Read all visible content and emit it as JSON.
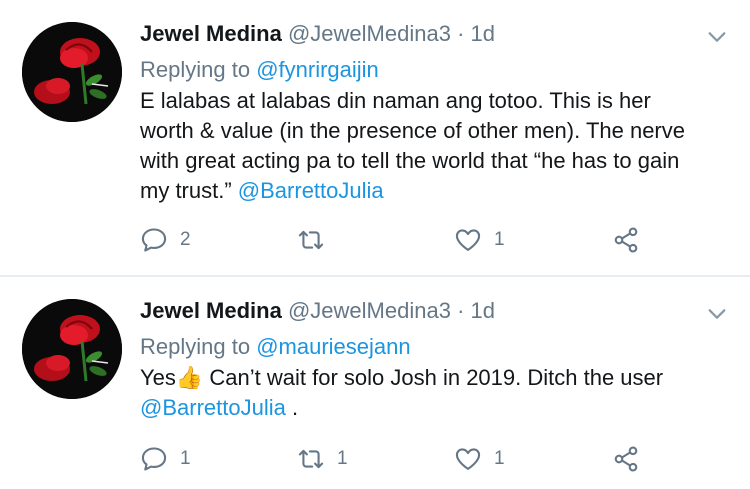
{
  "tweets": [
    {
      "author_name": "Jewel Medina",
      "handle": "@JewelMedina3",
      "separator": "·",
      "time": "1d",
      "replying_prefix": "Replying to",
      "replying_to": "@fynrirgaijin",
      "text_lines": [
        "E lalabas at lalabas din naman ang totoo. This is her",
        "worth & value (in the presence of other men). The nerve",
        "with great acting pa to tell the world that “he has to gain",
        "my trust.”"
      ],
      "trailing_mention": "@BarrettoJulia",
      "reply_count": "2",
      "retweet_count": "",
      "like_count": "1"
    },
    {
      "author_name": "Jewel Medina",
      "handle": "@JewelMedina3",
      "separator": "·",
      "time": "1d",
      "replying_prefix": "Replying to",
      "replying_to": "@mauriesejann",
      "text_before_emoji": "Yes",
      "emoji": "👍",
      "text_after_emoji": " Can’t wait for solo Josh in 2019. Ditch the user",
      "trailing_mention": "@BarrettoJulia",
      "trailing_text": " .",
      "reply_count": "1",
      "retweet_count": "1",
      "like_count": "1"
    }
  ],
  "icons": {
    "reply": "reply-icon",
    "retweet": "retweet-icon",
    "like": "heart-icon",
    "share": "share-icon",
    "caret": "chevron-down-icon"
  },
  "colors": {
    "mention": "#1b95e0",
    "secondary_text": "#657786",
    "primary_text": "#14171a",
    "divider": "#e6ecf0"
  }
}
